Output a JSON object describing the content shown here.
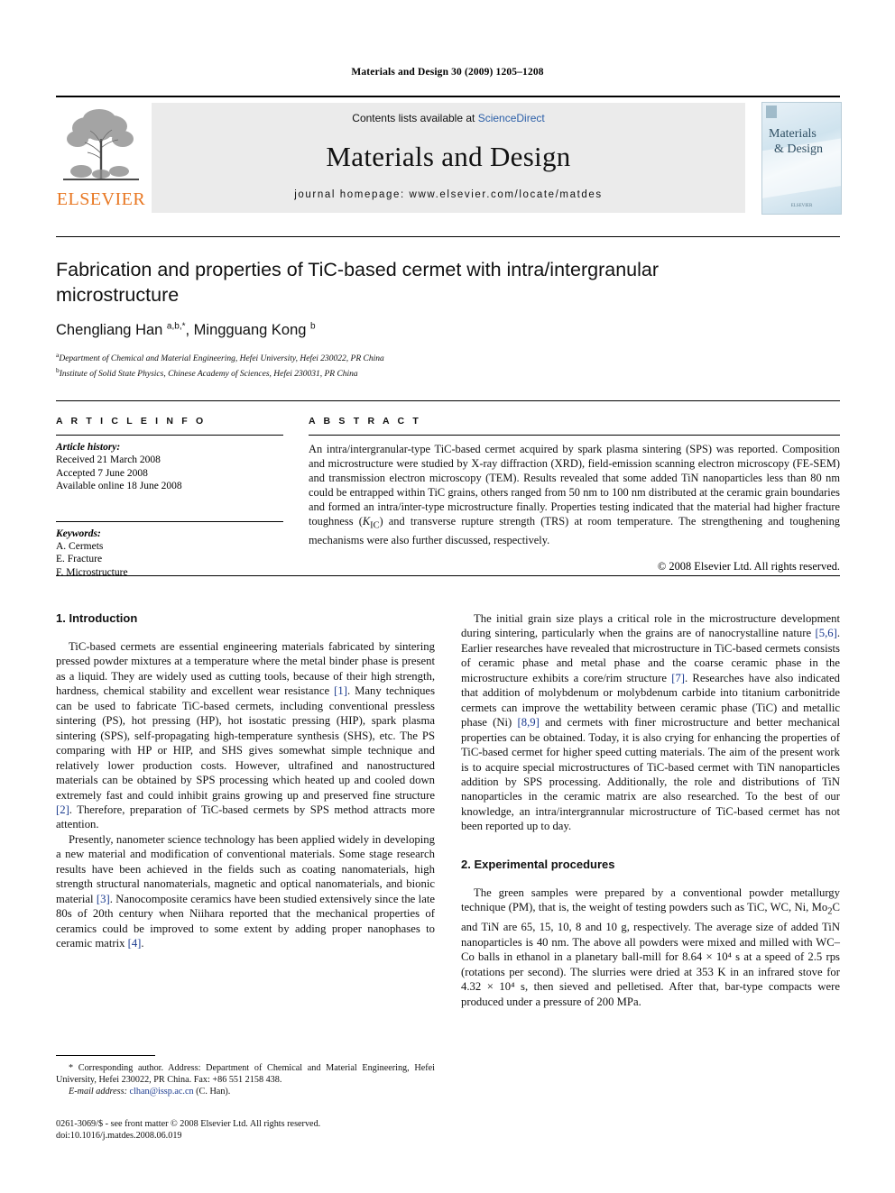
{
  "running_head": "Materials and Design 30 (2009) 1205–1208",
  "masthead": {
    "publisher_name": "ELSEVIER",
    "contents_prefix": "Contents lists available at ",
    "contents_link": "ScienceDirect",
    "journal_title": "Materials and Design",
    "homepage": "journal homepage: www.elsevier.com/locate/matdes",
    "cover": {
      "line1": "Materials",
      "line2": "& Design",
      "footer": "ELSEVIER"
    }
  },
  "article": {
    "title": "Fabrication and properties of TiC-based cermet with intra/intergranular microstructure",
    "authors_html": "Chengliang Han <sup>a,b,*</sup>, Mingguang Kong <sup>b</sup>",
    "affiliations": [
      {
        "marker": "a",
        "text": "Department of Chemical and Material Engineering, Hefei University, Hefei 230022, PR China"
      },
      {
        "marker": "b",
        "text": "Institute of Solid State Physics, Chinese Academy of Sciences, Hefei 230031, PR China"
      }
    ]
  },
  "info": {
    "heading": "A R T I C L E    I N F O",
    "history_label": "Article history:",
    "history": [
      "Received 21 March 2008",
      "Accepted 7 June 2008",
      "Available online 18 June 2008"
    ],
    "keywords_label": "Keywords:",
    "keywords": [
      "A. Cermets",
      "E. Fracture",
      "F. Microstructure"
    ]
  },
  "abstract": {
    "heading": "A B S T R A C T",
    "text": "An intra/intergranular-type TiC-based cermet acquired by spark plasma sintering (SPS) was reported. Composition and microstructure were studied by X-ray diffraction (XRD), field-emission scanning electron microscopy (FE-SEM) and transmission electron microscopy (TEM). Results revealed that some added TiN nanoparticles less than 80 nm could be entrapped within TiC grains, others ranged from 50 nm to 100 nm distributed at the ceramic grain boundaries and formed an intra/inter-type microstructure finally. Properties testing indicated that the material had higher fracture toughness (KIC) and transverse rupture strength (TRS) at room temperature. The strengthening and toughening mechanisms were also further discussed, respectively.",
    "copyright": "© 2008 Elsevier Ltd. All rights reserved."
  },
  "body": {
    "intro_heading": "1. Introduction",
    "intro_p1": "TiC-based cermets are essential engineering materials fabricated by sintering pressed powder mixtures at a temperature where the metal binder phase is present as a liquid. They are widely used as cutting tools, because of their high strength, hardness, chemical stability and excellent wear resistance [1]. Many techniques can be used to fabricate TiC-based cermets, including conventional pressless sintering (PS), hot pressing (HP), hot isostatic pressing (HIP), spark plasma sintering (SPS), self-propagating high-temperature synthesis (SHS), etc. The PS comparing with HP or HIP, and SHS gives somewhat simple technique and relatively lower production costs. However, ultrafined and nanostructured materials can be obtained by SPS processing which heated up and cooled down extremely fast and could inhibit grains growing up and preserved fine structure [2]. Therefore, preparation of TiC-based cermets by SPS method attracts more attention.",
    "intro_p2": "Presently, nanometer science technology has been applied widely in developing a new material and modification of conventional materials. Some stage research results have been achieved in the fields such as coating nanomaterials, high strength structural nanomaterials, magnetic and optical nanomaterials, and bionic material [3]. Nanocomposite ceramics have been studied extensively since the late 80s of 20th century when Niihara reported that the mechanical properties of ceramics could be improved to some extent by adding proper nanophases to ceramic matrix [4].",
    "right_p1": "The initial grain size plays a critical role in the microstructure development during sintering, particularly when the grains are of nanocrystalline nature [5,6]. Earlier researches have revealed that microstructure in TiC-based cermets consists of ceramic phase and metal phase and the coarse ceramic phase in the microstructure exhibits a core/rim structure [7]. Researches have also indicated that addition of molybdenum or molybdenum carbide into titanium carbonitride cermets can improve the wettability between ceramic phase (TiC) and metallic phase (Ni) [8,9] and cermets with finer microstructure and better mechanical properties can be obtained. Today, it is also crying for enhancing the properties of TiC-based cermet for higher speed cutting materials. The aim of the present work is to acquire special microstructures of TiC-based cermet with TiN nanoparticles addition by SPS processing. Additionally, the role and distributions of TiN nanoparticles in the ceramic matrix are also researched. To the best of our knowledge, an intra/intergrannular microstructure of TiC-based cermet has not been reported up to day.",
    "exp_heading": "2. Experimental procedures",
    "exp_p1": "The green samples were prepared by a conventional powder metallurgy technique (PM), that is, the weight of testing powders such as TiC, WC, Ni, Mo2C and TiN are 65, 15, 10, 8 and 10 g, respectively. The average size of added TiN nanoparticles is 40 nm. The above all powders were mixed and milled with WC–Co balls in ethanol in a planetary ball-mill for 8.64 × 10⁴ s at a speed of 2.5 rps (rotations per second). The slurries were dried at 353 K in an infrared stove for 4.32 × 10⁴ s, then sieved and pelletised. After that, bar-type compacts were produced under a pressure of 200 MPa."
  },
  "footer": {
    "corresponding_note": "Corresponding author. Address: Department of Chemical and Material Engineering, Hefei University, Hefei 230022, PR China. Fax: +86 551 2158 438.",
    "email_label": "E-mail address:",
    "email": "clhan@issp.ac.cn",
    "email_owner": "(C. Han).",
    "issn_line": "0261-3069/$ - see front matter © 2008 Elsevier Ltd. All rights reserved.",
    "doi_line": "doi:10.1016/j.matdes.2008.06.019"
  },
  "colors": {
    "elsevier_orange": "#E87722",
    "link_blue": "#2b5fa8",
    "ref_blue": "#1a3a8f"
  }
}
